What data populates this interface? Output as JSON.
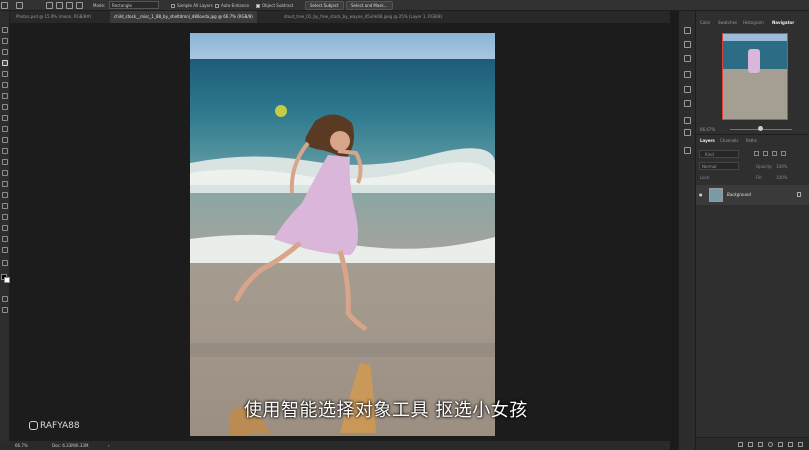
{
  "options_bar": {
    "mode_label": "Mode:",
    "mode_value": "Rectangle",
    "sample_all_layers": "Sample All Layers",
    "auto_enhance": "Auto-Enhance",
    "object_subtract": "Object Subtract",
    "select_subject": "Select Subject",
    "select_and_mask": "Select and Mask..."
  },
  "documents": {
    "tabs": [
      {
        "label": "Photos.psd @ 15.9% (moon, RGB/8#)"
      },
      {
        "label": "child_stock__misc_1_88_by_sheltdmnl_d80ovda.jpg @ 66.7% (RGB/8)"
      },
      {
        "label": "stout_tree_01_by_free_stock_by_wayne_d5uhk68.jpeg @ 25% (Layer 1, RGB/8)"
      }
    ]
  },
  "status": {
    "zoom": "66.7%",
    "doc_size": "Doc: 6.33M/6.33M"
  },
  "right_panel": {
    "top_tabs": [
      "Color",
      "Swatches",
      "Histogram",
      "Navigator"
    ],
    "navigator_zoom": "66.67%",
    "layer_tabs": [
      "Layers",
      "Channels",
      "Paths"
    ],
    "kind_label": "Kind",
    "blend_mode": "Normal",
    "opacity_label": "Opacity:",
    "opacity_value": "100%",
    "lock_label": "Lock:",
    "fill_label": "Fill:",
    "fill_value": "100%",
    "layers": [
      {
        "name": "Background"
      }
    ]
  },
  "overlay": {
    "subtitle": "使用智能选择对象工具 抠选小女孩",
    "watermark": "RAFYA88"
  },
  "colors": {
    "ui_dark": "#1c1c1c",
    "panel": "#2f2f2f",
    "navigator_frame": "#e0403a"
  }
}
